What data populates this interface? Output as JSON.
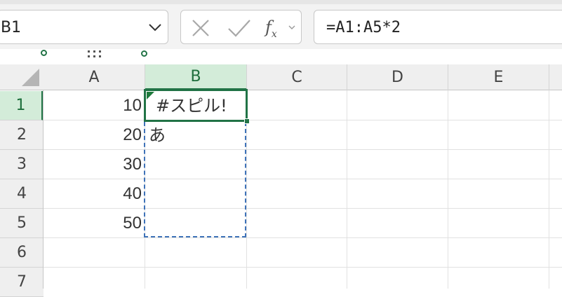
{
  "namebox": {
    "value": "B1"
  },
  "formula_bar": {
    "formula": "=A1:A5*2"
  },
  "columns": [
    "A",
    "B",
    "C",
    "D",
    "E"
  ],
  "rows": [
    "1",
    "2",
    "3",
    "4",
    "5",
    "6",
    "7"
  ],
  "active_cell": "B1",
  "cells": {
    "A1": "10",
    "A2": "20",
    "A3": "30",
    "A4": "40",
    "A5": "50",
    "B1": "#スピル!",
    "B2": "あ"
  },
  "icons": {
    "namebox_dropdown": "chevron-down-icon",
    "cancel": "close-icon",
    "enter": "checkmark-icon",
    "insert_function": "function-icon"
  },
  "colors": {
    "accent": "#217346",
    "active_header_bg": "#d3ecd9",
    "spill_border": "#3e72b8"
  }
}
